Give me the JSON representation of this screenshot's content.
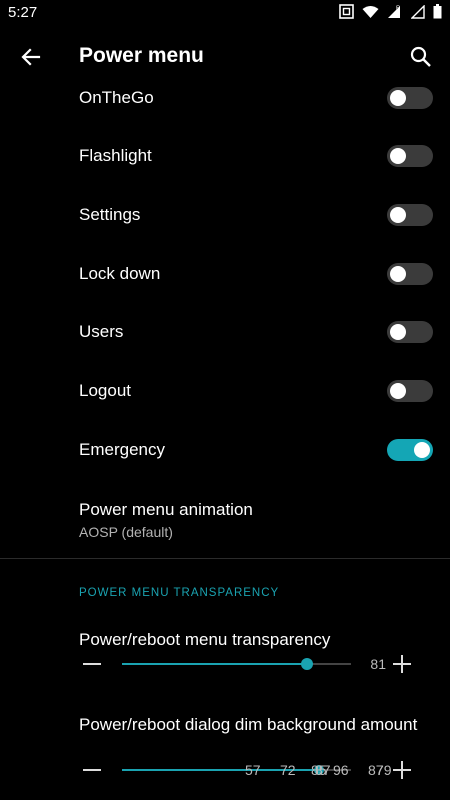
{
  "status_bar": {
    "time": "5:27",
    "icons": [
      "nfc-icon",
      "wifi-icon",
      "signal-r-icon",
      "signal-icon",
      "battery-icon"
    ]
  },
  "app_bar": {
    "title": "Power menu",
    "back_icon": "arrow-back-icon",
    "search_icon": "search-icon"
  },
  "toggles": [
    {
      "label": "OnTheGo",
      "on": false
    },
    {
      "label": "Flashlight",
      "on": false
    },
    {
      "label": "Settings",
      "on": false
    },
    {
      "label": "Lock down",
      "on": false
    },
    {
      "label": "Users",
      "on": false
    },
    {
      "label": "Logout",
      "on": false
    },
    {
      "label": "Emergency",
      "on": true
    }
  ],
  "animation": {
    "title": "Power menu animation",
    "summary": "AOSP (default)"
  },
  "transparency_section": {
    "header": "POWER MENU TRANSPARENCY",
    "menu_transparency": {
      "title": "Power/reboot menu transparency",
      "value": "81",
      "max": 100
    },
    "dialog_dim": {
      "title": "Power/reboot dialog dim background amount",
      "overlapping_values": [
        "57",
        "72",
        "85",
        "87",
        "96",
        "87",
        "79"
      ]
    }
  },
  "colors": {
    "accent": "#1aa3b1",
    "background": "#000000",
    "switch_off": "#3b3b3b"
  }
}
